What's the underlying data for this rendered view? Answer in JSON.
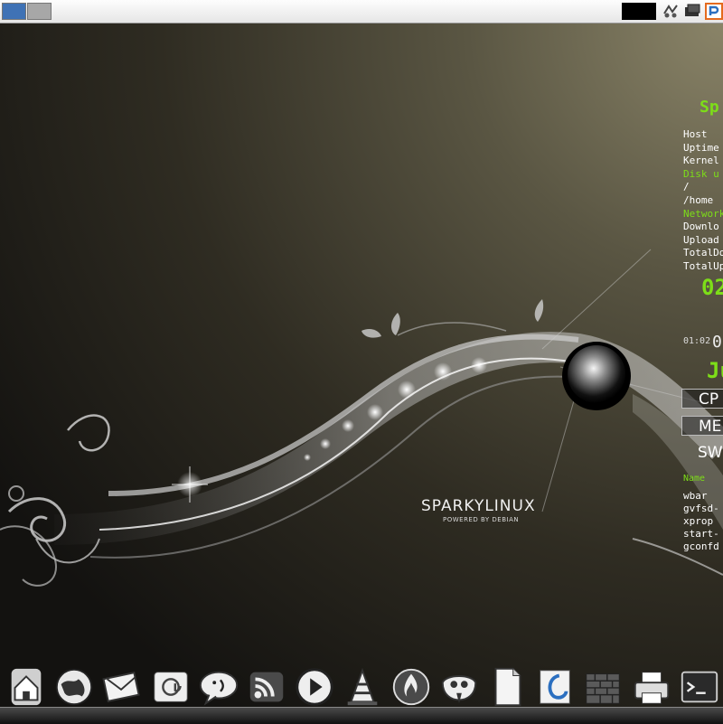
{
  "desktop": {
    "workspaces": [
      "workspace-1",
      "workspace-2"
    ],
    "tray_icons": [
      "network-icon",
      "display-icon",
      "software-updates-icon"
    ]
  },
  "wallpaper": {
    "logo": "SPARKYLINUX",
    "logo_sub": "POWERED BY DEBIAN"
  },
  "conky": {
    "title": "Sp",
    "lines": [
      {
        "text": "Host",
        "color": "white"
      },
      {
        "text": "Uptime",
        "color": "white"
      },
      {
        "text": "Kernel",
        "color": "white"
      },
      {
        "text": "Disk u",
        "color": "green"
      },
      {
        "text": "/",
        "color": "white"
      },
      {
        "text": "/home",
        "color": "white"
      },
      {
        "text": "Network",
        "color": "green"
      },
      {
        "text": "Downlo",
        "color": "white"
      },
      {
        "text": "Upload",
        "color": "white"
      },
      {
        "text": "TotalDo",
        "color": "white"
      },
      {
        "text": "TotalUp",
        "color": "white"
      }
    ],
    "clock": "02",
    "time_small": "01:02",
    "time_large": "0",
    "date": "Ju",
    "cpu": "CP",
    "mem": "ME",
    "swap": "SW",
    "process_header": "Name",
    "processes": [
      "wbar",
      "gvfsd-",
      "xprop",
      "start-",
      "gconfd"
    ]
  },
  "colors": {
    "accent_green": "#7dde18",
    "workspace_active": "#3f72b5"
  },
  "dock": [
    {
      "name": "home-icon"
    },
    {
      "name": "web-browser-icon"
    },
    {
      "name": "email-icon"
    },
    {
      "name": "email-at-icon"
    },
    {
      "name": "chat-icon"
    },
    {
      "name": "rss-icon"
    },
    {
      "name": "media-player-icon"
    },
    {
      "name": "vlc-icon"
    },
    {
      "name": "firewall-flame-icon"
    },
    {
      "name": "gimp-icon"
    },
    {
      "name": "text-editor-icon"
    },
    {
      "name": "disc-burner-icon"
    },
    {
      "name": "firewall-wall-icon"
    },
    {
      "name": "printer-icon"
    },
    {
      "name": "terminal-icon"
    }
  ]
}
